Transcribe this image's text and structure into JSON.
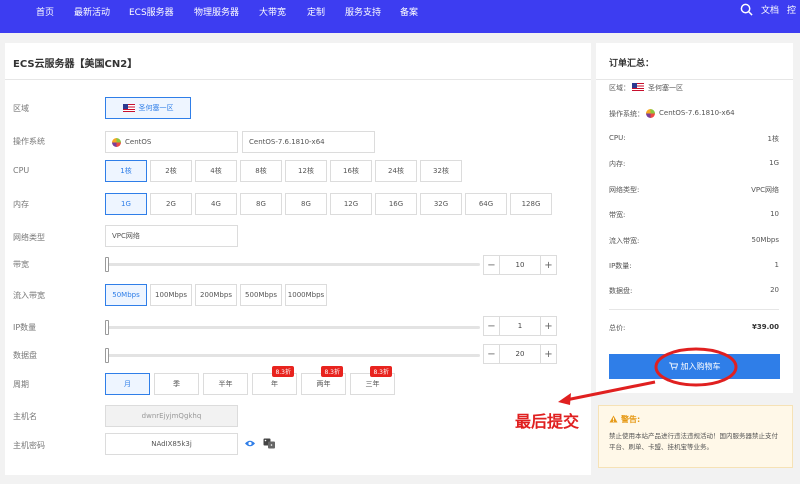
{
  "nav": {
    "items": [
      "首页",
      "最新活动",
      "ECS服务器",
      "物理服务器",
      "大带宽",
      "定制",
      "服务支持",
      "备案"
    ],
    "doc_label": "文档",
    "right_partial": "控"
  },
  "config": {
    "title": "ECS云服务器【美国CN2】",
    "region": {
      "label": "区域",
      "value": "圣何塞一区"
    },
    "os": {
      "label": "操作系统",
      "family": "CentOS",
      "version": "CentOS-7.6.1810-x64"
    },
    "cpu": {
      "label": "CPU",
      "options": [
        "1核",
        "2核",
        "4核",
        "8核",
        "12核",
        "16核",
        "24核",
        "32核"
      ],
      "selected": 0
    },
    "memory": {
      "label": "内存",
      "options": [
        "1G",
        "2G",
        "4G",
        "8G",
        "8G",
        "12G",
        "16G",
        "32G",
        "64G",
        "128G"
      ],
      "selected": 0
    },
    "network": {
      "label": "网络类型",
      "value": "VPC网络"
    },
    "bandwidth": {
      "label": "带宽",
      "value": "10",
      "level": 0
    },
    "inbound": {
      "label": "流入带宽",
      "options": [
        "50Mbps",
        "100Mbps",
        "200Mbps",
        "500Mbps",
        "1000Mbps"
      ],
      "selected": 0
    },
    "ip_count": {
      "label": "IP数量",
      "value": "1",
      "level": 0
    },
    "data_disk": {
      "label": "数据盘",
      "value": "20",
      "level": 0
    },
    "period": {
      "label": "周期",
      "options": [
        "月",
        "季",
        "半年",
        "年",
        "两年",
        "三年"
      ],
      "badges": [
        "",
        "",
        "",
        "8.3折",
        "8.3折",
        "8.3折"
      ],
      "selected": 0
    },
    "hostname": {
      "label": "主机名",
      "value": "dwnrEjyjmQgkhq"
    },
    "password": {
      "label": "主机密码",
      "value": "NAdIX85k3j"
    }
  },
  "summary": {
    "title": "订单汇总：",
    "region_label": "区域：",
    "region_value": "圣何塞一区",
    "os_label": "操作系统：",
    "os_value": "CentOS-7.6.1810-x64",
    "rows": [
      {
        "label": "CPU:",
        "value": "1核"
      },
      {
        "label": "内存:",
        "value": "1G"
      },
      {
        "label": "网络类型:",
        "value": "VPC网络"
      },
      {
        "label": "带宽:",
        "value": "10"
      },
      {
        "label": "流入带宽:",
        "value": "50Mbps"
      },
      {
        "label": "IP数量:",
        "value": "1"
      },
      {
        "label": "数据盘:",
        "value": "20"
      }
    ],
    "total_label": "总价:",
    "total_value": "¥39.00",
    "cart_button": "加入购物车"
  },
  "warning": {
    "title": "警告:",
    "text": "禁止使用本站产品进行违法违规活动！国内服务器禁止支付平台、刷单、卡盟、挂机宝等业务。"
  },
  "annotation": {
    "text": "最后提交"
  },
  "colors": {
    "nav": "#3d3df1",
    "accent": "#2f7ee8",
    "annotation": "#e02020",
    "badge": "#e8231e"
  }
}
